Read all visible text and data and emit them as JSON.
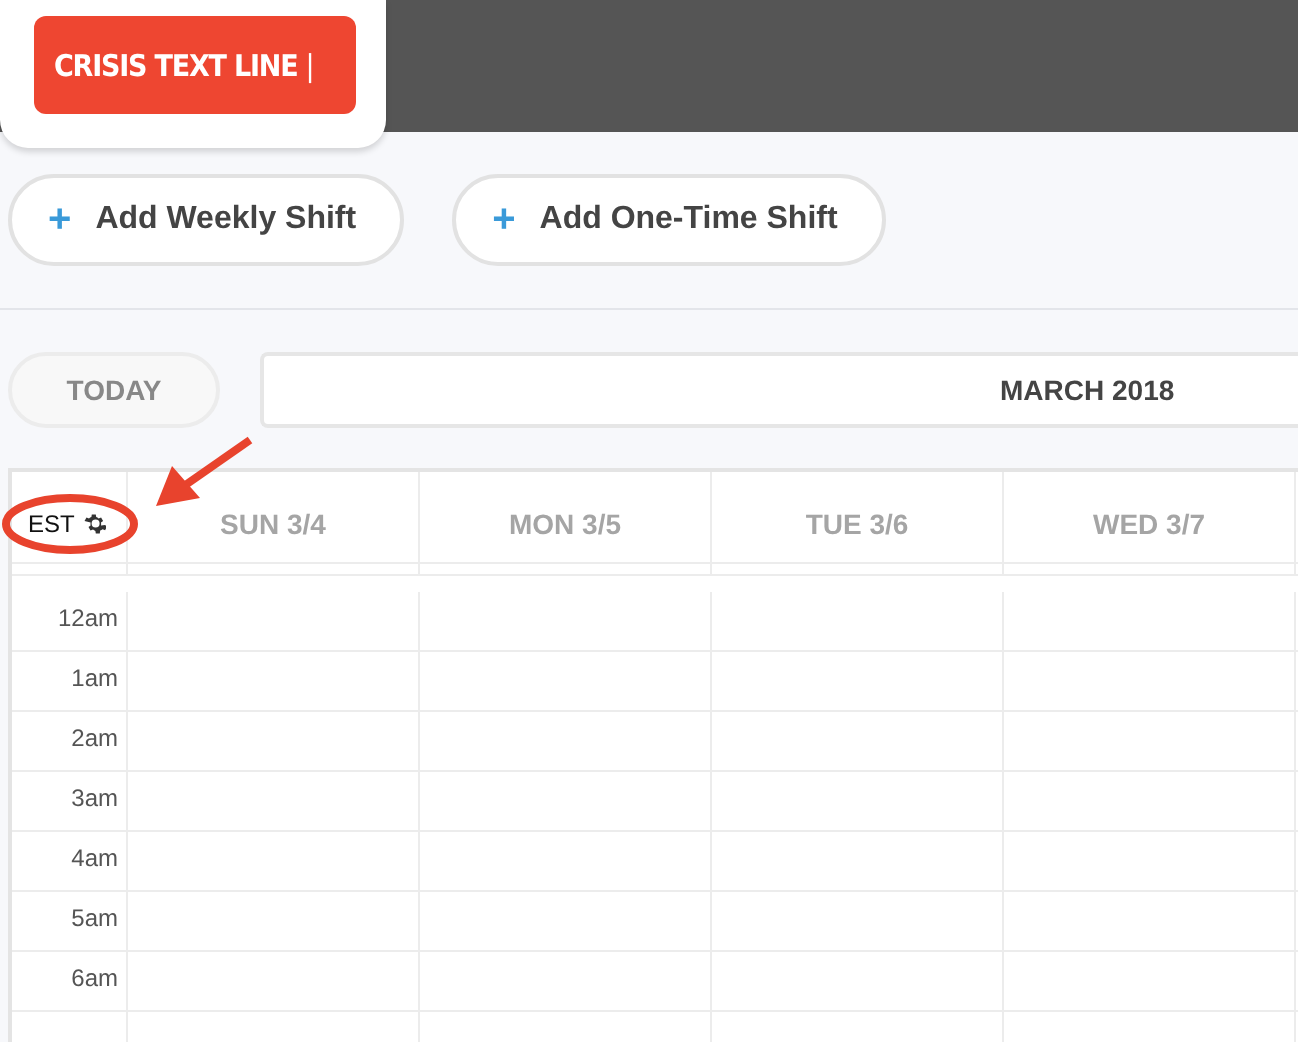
{
  "logo": {
    "text": "CRISIS TEXT LINE",
    "cursor": "|"
  },
  "actions": [
    {
      "label": "Add Weekly Shift",
      "icon": "+"
    },
    {
      "label": "Add One-Time Shift",
      "icon": "+"
    }
  ],
  "navigation": {
    "today": "TODAY",
    "month": "MARCH 2018"
  },
  "calendar": {
    "timezone": "EST",
    "days": [
      "SUN 3/4",
      "MON 3/5",
      "TUE 3/6",
      "WED 3/7"
    ],
    "hours": [
      "12am",
      "1am",
      "2am",
      "3am",
      "4am",
      "5am",
      "6am"
    ]
  }
}
